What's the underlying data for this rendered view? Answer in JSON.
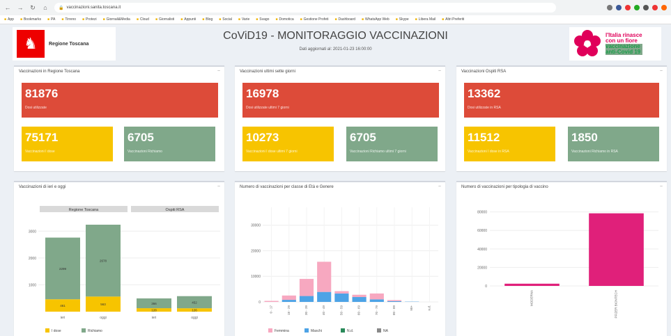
{
  "browser": {
    "url": "vaccinazioni.sanita.toscana.it",
    "bookmarks": [
      "App",
      "Bookmarks",
      "PA",
      "Tirreno",
      "Protezi",
      "Giornali&Media",
      "Cloud",
      "Giornalisti",
      "Appunti",
      "Blog",
      "Social",
      "Varie",
      "Svago",
      "Domotica",
      "Gestione Profeti",
      "Dashboard",
      "WhatsApp Web",
      "Skype",
      "Libera Mail",
      "Altri Preferiti"
    ]
  },
  "header": {
    "region": "Regione Toscana",
    "title": "CoViD19 - MONITORAGGIO VACCINAZIONI",
    "subtitle": "Dati aggiornati al: 2021-01-23 16:00:00",
    "campaign_line1": "l'Italia rinasce",
    "campaign_line2": "con un fiore",
    "campaign_line3": "vaccinazione",
    "campaign_line4": "anti-Covid 19"
  },
  "panels": {
    "toscana": {
      "title": "Vaccinazioni in Regione Toscana",
      "total": "81876",
      "total_label": "Dosi utilizzate",
      "first": "75171",
      "first_label": "Vaccinazioni I dose",
      "recall": "6705",
      "recall_label": "Vaccinazioni Richiamo"
    },
    "week": {
      "title": "Vaccinazioni ultimi sette giorni",
      "total": "16978",
      "total_label": "Dosi utilizzate ultimi 7 giorni",
      "first": "10273",
      "first_label": "Vaccinazioni I dose ultimi 7 giorni",
      "recall": "6705",
      "recall_label": "Vaccinazioni Richiamo ultimi 7 giorni"
    },
    "rsa": {
      "title": "Vaccinazioni Ospiti RSA",
      "total": "13362",
      "total_label": "Dosi utilizzate in RSA",
      "first": "11512",
      "first_label": "Vaccinazioni I dose in RSA",
      "recall": "1850",
      "recall_label": "Vaccinazioni Richiamo in RSA"
    }
  },
  "charts": {
    "ieri_oggi_title": "Vaccinazioni di ieri e oggi",
    "eta_title": "Numero di vaccinazioni per classe di Età e Genere",
    "tipologia_title": "Numero di vaccinazioni per tipologia di vaccino"
  },
  "chart_data": [
    {
      "type": "bar",
      "facets": [
        "Regione Toscana",
        "Ospiti RSA"
      ],
      "categories": [
        "ieri",
        "oggi"
      ],
      "series": [
        {
          "name": "I dose",
          "values_regione": [
            461,
            563
          ],
          "values_rsa": [
            128,
            126
          ],
          "color": "#f7c400"
        },
        {
          "name": "Richiamo",
          "values_regione": [
            2299,
            2678
          ],
          "values_rsa": [
            366,
            452
          ],
          "color": "#80a88a"
        }
      ],
      "ylim": [
        0,
        3500
      ],
      "yticks": [
        1000,
        2000,
        3000
      ]
    },
    {
      "type": "bar",
      "categories": [
        "0 - 17",
        "18 - 29",
        "30 - 39",
        "40 - 49",
        "50 - 59",
        "60 - 69",
        "70 - 79",
        "80 - 89",
        "90+",
        "n.d."
      ],
      "series": [
        {
          "name": "Femmina",
          "values": [
            400,
            1700,
            6700,
            11800,
            900,
            900,
            2300,
            400,
            0,
            0
          ],
          "color": "#f7a8c0"
        },
        {
          "name": "Maschi",
          "values": [
            0,
            800,
            2300,
            3900,
            3300,
            1900,
            1000,
            300,
            100,
            0
          ],
          "color": "#4da3e6"
        },
        {
          "name": "N.d.",
          "values": [
            0,
            0,
            0,
            0,
            0,
            0,
            0,
            0,
            0,
            0
          ],
          "color": "#2a8a5a"
        },
        {
          "name": "NA",
          "values": [
            0,
            0,
            0,
            0,
            0,
            0,
            0,
            0,
            0,
            0
          ],
          "color": "#888888"
        }
      ],
      "ylim": [
        0,
        37000
      ],
      "yticks": [
        0,
        10000,
        20000,
        30000
      ]
    },
    {
      "type": "bar",
      "categories": [
        "MODERNA",
        "PFIZER BIONTECH"
      ],
      "values": [
        2400,
        78500
      ],
      "color": "#e0207a",
      "ylim": [
        0,
        85000
      ],
      "yticks": [
        0,
        20000,
        40000,
        60000,
        80000
      ]
    }
  ]
}
